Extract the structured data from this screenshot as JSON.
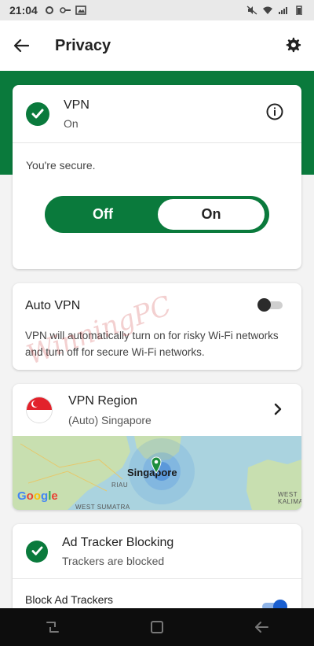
{
  "status_bar": {
    "time": "21:04"
  },
  "header": {
    "title": "Privacy"
  },
  "vpn": {
    "title": "VPN",
    "state": "On",
    "secure_text": "You're secure.",
    "segment_off": "Off",
    "segment_on": "On",
    "selected": "On"
  },
  "auto_vpn": {
    "title": "Auto VPN",
    "description": "VPN will automatically turn on for risky Wi-Fi networks and turn off for secure Wi-Fi networks.",
    "enabled": false
  },
  "vpn_region": {
    "title": "VPN Region",
    "value": "(Auto) Singapore",
    "map": {
      "city": "Singapore",
      "labels": [
        "RIAU",
        "WEST SUMATRA",
        "WEST KALIMANT"
      ],
      "attribution": "Google"
    }
  },
  "ad_tracker": {
    "title": "Ad Tracker Blocking",
    "status": "Trackers are blocked",
    "block_row_label": "Block Ad Trackers",
    "block_enabled": true
  },
  "watermark": "WinningPC",
  "colors": {
    "brand_green": "#0a7a3c",
    "toggle_blue": "#1a5fd0"
  }
}
